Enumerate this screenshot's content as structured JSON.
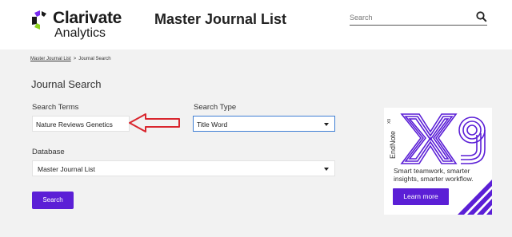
{
  "header": {
    "logo_name": "Clarivate",
    "logo_sub": "Analytics",
    "site_title": "Master Journal List",
    "search_placeholder": "Search"
  },
  "breadcrumb": {
    "home": "Master Journal List",
    "separator": ">",
    "current": "Journal Search"
  },
  "page_title": "Journal Search",
  "form": {
    "search_terms_label": "Search Terms",
    "search_terms_value": "Nature Reviews Genetics",
    "search_type_label": "Search Type",
    "search_type_value": "Title Word",
    "database_label": "Database",
    "database_value": "Master Journal List",
    "submit_label": "Search"
  },
  "ad": {
    "product_small": "EndNote",
    "product_superscript": "X9",
    "product_big": "X9",
    "tagline": "Smart teamwork, smarter insights, smarter workflow.",
    "cta": "Learn more"
  },
  "colors": {
    "brand_purple": "#5b1fd6",
    "arrow_red": "#d9262e",
    "select_focus_blue": "#3f7fd4"
  }
}
